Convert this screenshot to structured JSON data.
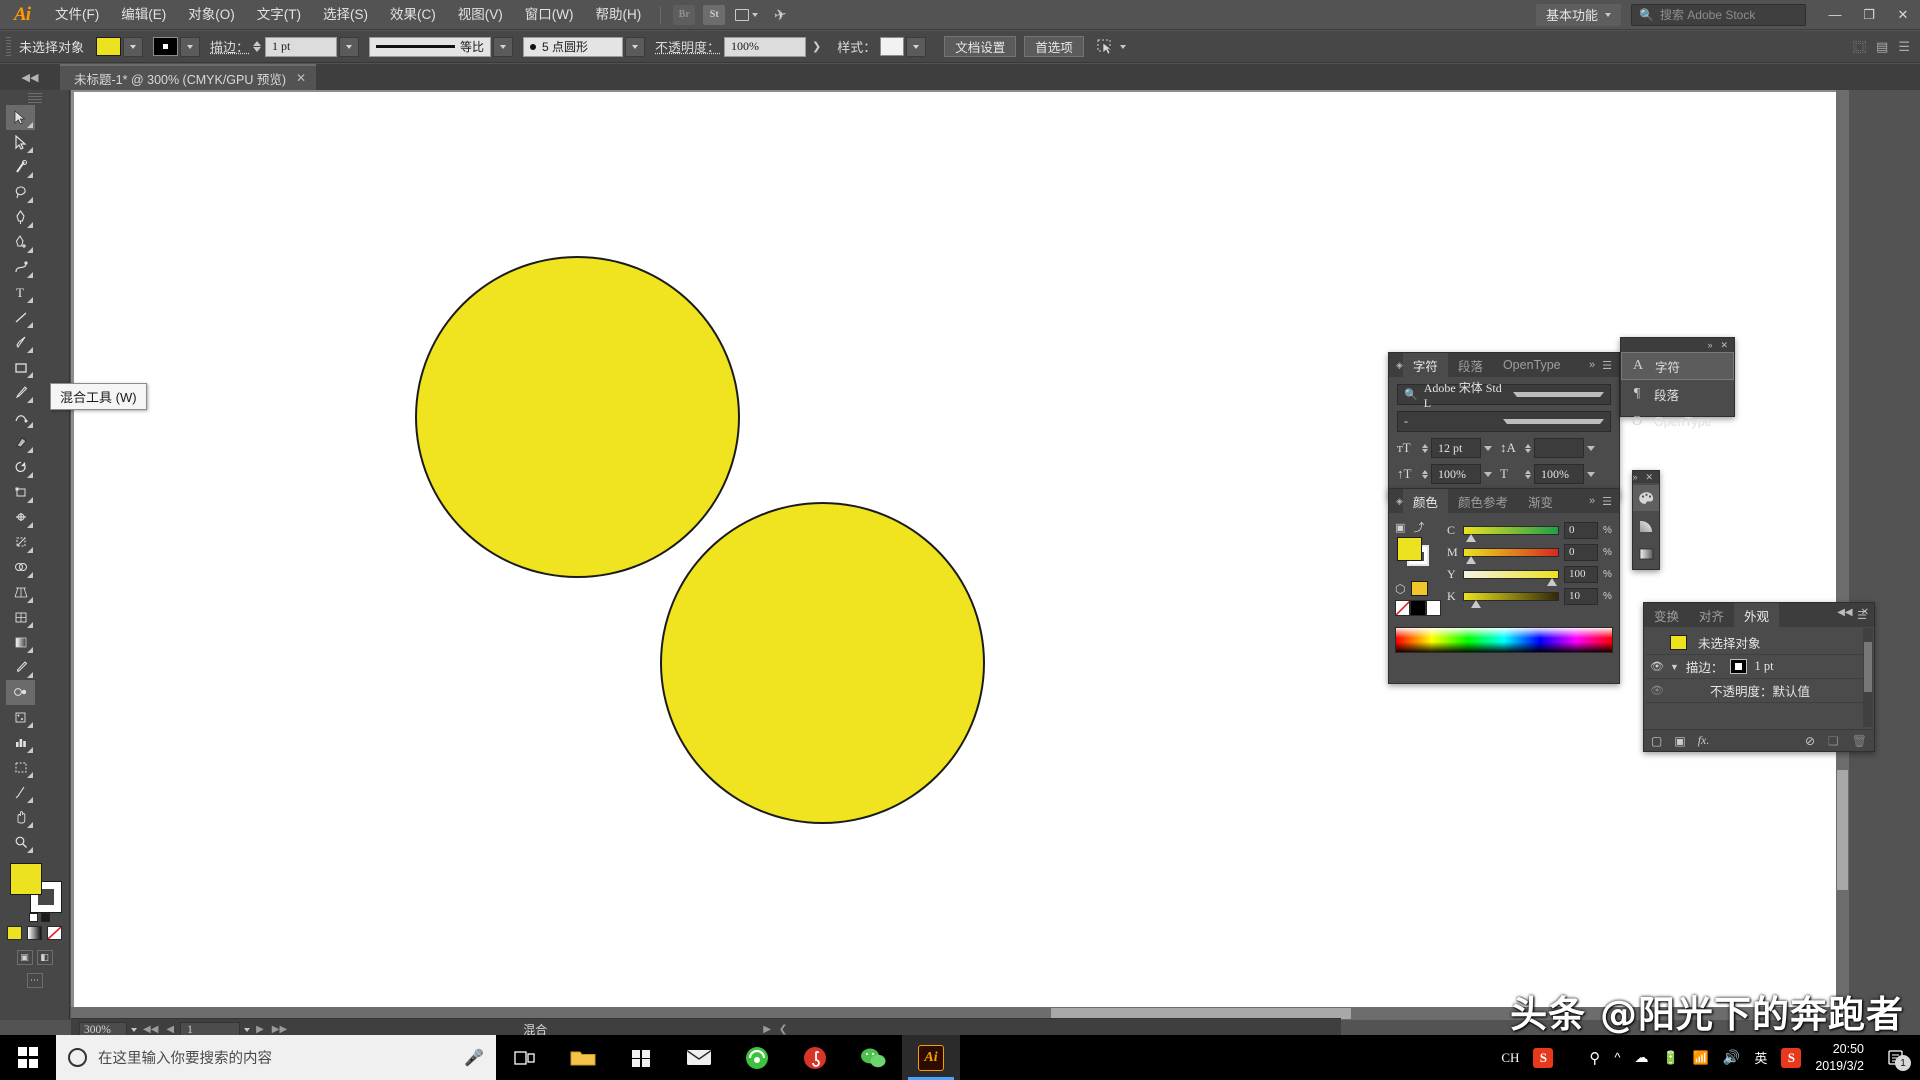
{
  "app": {
    "logo": "Ai"
  },
  "menubar": {
    "items": [
      "文件(F)",
      "编辑(E)",
      "对象(O)",
      "文字(T)",
      "选择(S)",
      "效果(C)",
      "视图(V)",
      "窗口(W)",
      "帮助(H)"
    ],
    "bridge_label": "Br",
    "stock_label": "St",
    "workspace": "基本功能",
    "search_placeholder": "搜索 Adobe Stock",
    "minimize": "—",
    "maximize": "❐",
    "close": "✕"
  },
  "controlbar": {
    "selection_label": "未选择对象",
    "fill_color": "#ede220",
    "stroke_label": "描边：",
    "stroke_weight": "1 pt",
    "profile_label": "等比",
    "brush_label": "5 点圆形",
    "opacity_label": "不透明度：",
    "opacity_value": "100%",
    "style_label": "样式：",
    "doc_setup": "文档设置",
    "preferences": "首选项"
  },
  "tabbar": {
    "document_title": "未标题-1* @ 300% (CMYK/GPU 预览)",
    "close_glyph": "✕"
  },
  "tooltip": {
    "text": "混合工具 (W)"
  },
  "canvas": {
    "circles": [
      {
        "fill": "#efe41f",
        "stroke": "#1b1b1b"
      },
      {
        "fill": "#efe41f",
        "stroke": "#1b1b1b"
      }
    ]
  },
  "character_panel": {
    "tabs": [
      "字符",
      "段落",
      "OpenType"
    ],
    "active_tab": "字符",
    "font_family": "Adobe 宋体 Std L",
    "font_style": "-",
    "font_size": "12 pt",
    "leading": "",
    "vertical_scale": "100%",
    "horizontal_scale": "100%"
  },
  "character_flyout": {
    "items": [
      {
        "icon": "A",
        "label": "字符"
      },
      {
        "icon": "¶",
        "label": "段落"
      },
      {
        "icon": "O",
        "label": "OpenType"
      }
    ]
  },
  "dock_icons": {
    "items": [
      "palette-icon",
      "gradient-mesh-icon",
      "gradient-bar-icon"
    ]
  },
  "color_panel": {
    "tabs": [
      "颜色",
      "颜色参考",
      "渐变"
    ],
    "active_tab": "颜色",
    "fill_color": "#ede220",
    "mode": "CMYK",
    "channels": [
      {
        "name": "C",
        "value": "0",
        "unit": "%",
        "pos": 4,
        "grad": "linear-gradient(to right,#ece11f,#1f9f4a)"
      },
      {
        "name": "M",
        "value": "0",
        "unit": "%",
        "pos": 4,
        "grad": "linear-gradient(to right,#ece11f,#d62a1e)"
      },
      {
        "name": "Y",
        "value": "100",
        "unit": "%",
        "pos": 92,
        "grad": "linear-gradient(to right,#f4f2e2,#ece11f)"
      },
      {
        "name": "K",
        "value": "10",
        "unit": "%",
        "pos": 9,
        "grad": "linear-gradient(to right,#ece11f,#31290a)"
      }
    ]
  },
  "appearance_panel": {
    "tabs": [
      "变换",
      "对齐",
      "外观"
    ],
    "active_tab": "外观",
    "object_label": "未选择对象",
    "stroke_label": "描边：",
    "stroke_value": "1 pt",
    "opacity_label": "不透明度：默认值"
  },
  "statusbar": {
    "zoom": "300%",
    "page": "1",
    "tool_name": "混合"
  },
  "watermark": {
    "text": "头条 @阳光下的奔跑者"
  },
  "taskbar": {
    "search_placeholder": "在这里输入你要搜索的内容",
    "ime": "CH",
    "lang": "英",
    "time": "20:50",
    "date": "2019/3/2",
    "notification_count": "1"
  }
}
